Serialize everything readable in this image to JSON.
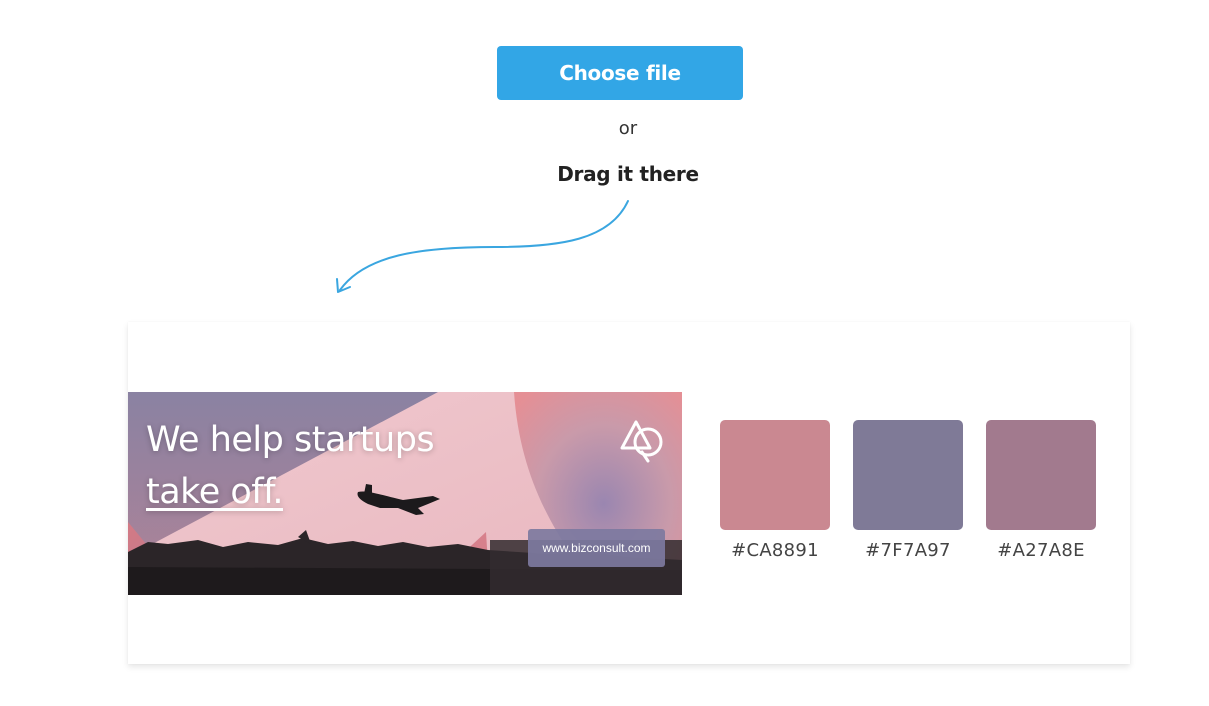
{
  "upload": {
    "choose_label": "Choose file",
    "or_label": "or",
    "drag_label": "Drag it there"
  },
  "colors": {
    "button": "#32A6E6",
    "arrow": "#3AA6E0"
  },
  "banner": {
    "heading_line1": "We help startups",
    "heading_line2": "take off.",
    "url": "www.bizconsult.com",
    "logo_icon": "triangle-circle-logo-icon"
  },
  "palette": [
    {
      "hex": "#CA8891",
      "label": "#CA8891"
    },
    {
      "hex": "#7F7A97",
      "label": "#7F7A97"
    },
    {
      "hex": "#A27A8E",
      "label": "#A27A8E"
    }
  ]
}
